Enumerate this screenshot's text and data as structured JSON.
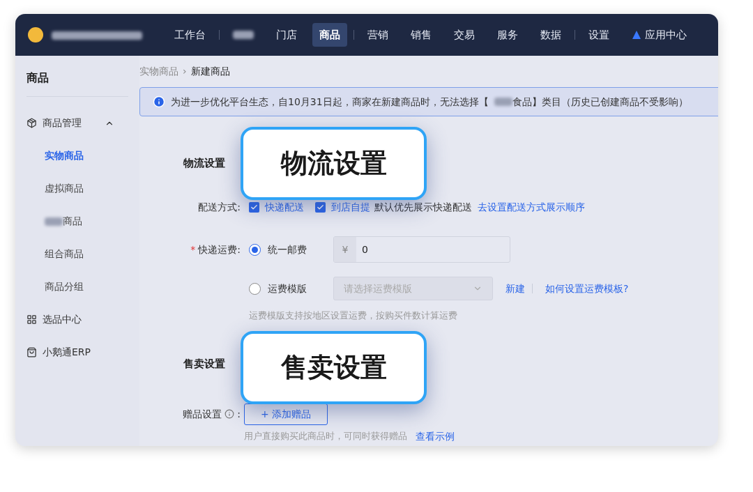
{
  "top_nav": {
    "items": [
      {
        "kind": "text",
        "label": "工作台",
        "selected": false,
        "divider_after": true
      },
      {
        "kind": "redacted",
        "selected": false,
        "divider_after": false
      },
      {
        "kind": "text",
        "label": "门店",
        "selected": false,
        "divider_after": false
      },
      {
        "kind": "text",
        "label": "商品",
        "selected": true,
        "divider_after": true
      },
      {
        "kind": "text",
        "label": "营销",
        "selected": false,
        "divider_after": false
      },
      {
        "kind": "text",
        "label": "销售",
        "selected": false,
        "divider_after": false
      },
      {
        "kind": "text",
        "label": "交易",
        "selected": false,
        "divider_after": false
      },
      {
        "kind": "text",
        "label": "服务",
        "selected": false,
        "divider_after": false
      },
      {
        "kind": "text",
        "label": "数据",
        "selected": false,
        "divider_after": true
      },
      {
        "kind": "text",
        "label": "设置",
        "selected": false,
        "divider_after": false
      },
      {
        "kind": "app",
        "label": "应用中心",
        "selected": false,
        "divider_after": false
      }
    ]
  },
  "sidebar": {
    "title": "商品",
    "items": [
      {
        "kind": "group",
        "label": "商品管理",
        "expanded": true,
        "children": [
          {
            "label": "实物商品",
            "selected": true,
            "redacted_prefix": false
          },
          {
            "label": "虚拟商品",
            "selected": false,
            "redacted_prefix": false
          },
          {
            "label": "商品",
            "selected": false,
            "redacted_prefix": true
          },
          {
            "label": "组合商品",
            "selected": false,
            "redacted_prefix": false
          },
          {
            "label": "商品分组",
            "selected": false,
            "redacted_prefix": false
          }
        ]
      },
      {
        "kind": "link",
        "label": "选品中心"
      },
      {
        "kind": "link",
        "label": "小鹅通ERP"
      }
    ]
  },
  "breadcrumb": {
    "items": [
      "实物商品",
      "新建商品"
    ],
    "separator": "›"
  },
  "notice": {
    "text_before": "为进一步优化平台生态，自10月31日起，商家在新建商品时，无法选择【",
    "text_after": "食品】类目（历史已创建商品不受影响）"
  },
  "logistics": {
    "heading": "物流设置",
    "callout": "物流设置",
    "delivery": {
      "label": "配送方式:",
      "options": [
        {
          "label": "快递配送",
          "checked": true
        },
        {
          "label": "到店自提",
          "checked": true
        }
      ],
      "note": "默认优先展示快递配送",
      "link": "去设置配送方式展示顺序"
    },
    "shipping": {
      "label": "快递运费:",
      "required_mark": "*",
      "options": [
        {
          "kind": "input",
          "label": "统一邮费",
          "selected": true,
          "prefix": "¥",
          "value": "0"
        },
        {
          "kind": "select",
          "label": "运费模版",
          "selected": false,
          "placeholder": "请选择运费模版",
          "links": [
            "新建",
            "如何设置运费模板?"
          ]
        }
      ],
      "hint": "运费模版支持按地区设置运费，按购买件数计算运费"
    }
  },
  "sales": {
    "heading": "售卖设置",
    "callout": "售卖设置",
    "gift": {
      "label": "赠品设置",
      "label_suffix": ":",
      "button": "+ 添加赠品",
      "hint": "用户直接购买此商品时，可同时获得赠品",
      "link": "查看示例"
    }
  }
}
